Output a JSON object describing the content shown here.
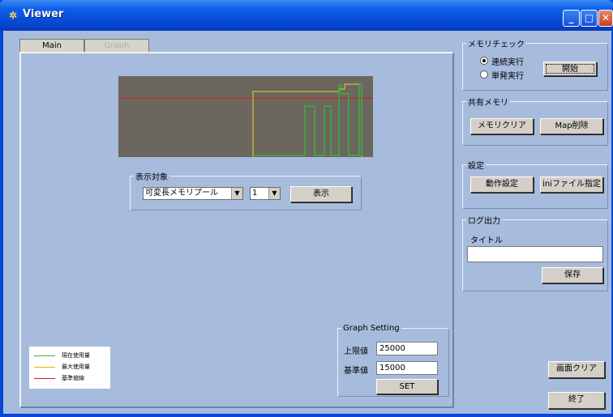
{
  "window": {
    "title": "Viewer",
    "icon": "app-icon"
  },
  "tabs": [
    {
      "label": "Main",
      "active": true
    },
    {
      "label": "Graph",
      "active": false
    }
  ],
  "display_target": {
    "legend": "表示対象",
    "pool_select": "可変長メモリプール",
    "index_select": "1",
    "show_button": "表示"
  },
  "legend": {
    "items": [
      {
        "label": "現在使用量",
        "color": "#2eb82e"
      },
      {
        "label": "最大使用量",
        "color": "#e8b000"
      },
      {
        "label": "基準値線",
        "color": "#e01010"
      }
    ]
  },
  "graph_setting": {
    "legend": "Graph Setting",
    "upper_label": "上限値",
    "upper_value": "25000",
    "base_label": "基準値",
    "base_value": "15000",
    "set_button": "SET"
  },
  "memory_check": {
    "legend": "メモリチェック",
    "radio_continuous": "連続実行",
    "radio_single": "単発実行",
    "selected": "連続実行",
    "start_button": "開始"
  },
  "shared_memory": {
    "legend": "共有メモリ",
    "clear_button": "メモリクリア",
    "map_delete_button": "Map削除"
  },
  "settings": {
    "legend": "設定",
    "operation_button": "動作設定",
    "ini_button": "iniファイル指定"
  },
  "log_output": {
    "legend": "ログ出力",
    "title_label": "タイトル",
    "title_value": "",
    "save_button": "保存"
  },
  "bottom": {
    "clear_screen_button": "画面クリア",
    "exit_button": "終了"
  },
  "colors": {
    "graph_bg": "#6b675f",
    "client_bg": "#a7bbdd",
    "titlebar": "#0a5fe8"
  }
}
